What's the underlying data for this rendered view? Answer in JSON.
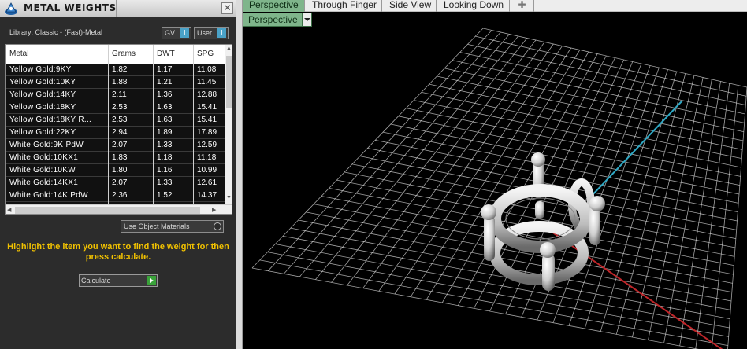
{
  "panel": {
    "title": "METAL WEIGHTS",
    "close_glyph": "✕",
    "library_label": "Library: Classic - (Fast)-Metal",
    "dropdown_gv": "GV",
    "dropdown_user": "User",
    "table": {
      "headers": [
        "Metal",
        "Grams",
        "DWT",
        "SPG"
      ],
      "rows": [
        [
          "Yellow Gold:9KY",
          "1.82",
          "1.17",
          "11.08"
        ],
        [
          "Yellow Gold:10KY",
          "1.88",
          "1.21",
          "11.45"
        ],
        [
          "Yellow Gold:14KY",
          "2.11",
          "1.36",
          "12.88"
        ],
        [
          "Yellow Gold:18KY",
          "2.53",
          "1.63",
          "15.41"
        ],
        [
          "Yellow Gold:18KY R...",
          "2.53",
          "1.63",
          "15.41"
        ],
        [
          "Yellow Gold:22KY",
          "2.94",
          "1.89",
          "17.89"
        ],
        [
          "White Gold:9K PdW",
          "2.07",
          "1.33",
          "12.59"
        ],
        [
          "White Gold:10KX1",
          "1.83",
          "1.18",
          "11.18"
        ],
        [
          "White Gold:10KW",
          "1.80",
          "1.16",
          "10.99"
        ],
        [
          "White Gold:14KX1",
          "2.07",
          "1.33",
          "12.61"
        ],
        [
          "White Gold:14K PdW",
          "2.36",
          "1.52",
          "14.37"
        ]
      ]
    },
    "use_object_materials": "Use Object Materials",
    "hint": "Highlight the item you want to find the weight for then press calculate.",
    "calculate_label": "Calculate"
  },
  "viewport": {
    "tabs": [
      "Perspective",
      "Through Finger",
      "Side View",
      "Looking Down"
    ],
    "active_tab": "Perspective",
    "add_tab_glyph": "✚",
    "view_dropdown": "Perspective"
  },
  "colors": {
    "accent_green": "#7fb58b",
    "hint_yellow": "#f2c200",
    "axis_x": "#c0262a",
    "axis_y": "#2fa8c4",
    "grid": "#d8d8d8"
  }
}
